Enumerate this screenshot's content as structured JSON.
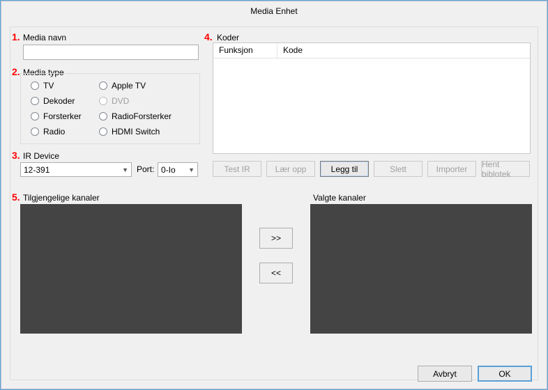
{
  "window": {
    "title": "Media Enhet"
  },
  "numbers": {
    "n1": "1.",
    "n2": "2.",
    "n3": "3.",
    "n4": "4.",
    "n5": "5."
  },
  "media_navn": {
    "label": "Media navn",
    "value": ""
  },
  "media_type": {
    "label": "Media type",
    "options": {
      "tv": "TV",
      "dekoder": "Dekoder",
      "forsterker": "Forsterker",
      "radio": "Radio",
      "apple_tv": "Apple TV",
      "dvd": "DVD",
      "radio_forsterker": "RadioForsterker",
      "hdmi_switch": "HDMI Switch"
    }
  },
  "ir_device": {
    "label": "IR Device",
    "value": "12-391",
    "port_label": "Port:",
    "port_value": "0-Io"
  },
  "koder": {
    "label": "Koder",
    "columns": {
      "funksjon": "Funksjon",
      "kode": "Kode"
    },
    "buttons": {
      "test_ir": "Test IR",
      "laer_opp": "Lær opp",
      "legg_til": "Legg til",
      "slett": "Slett",
      "importer": "Importer",
      "hent_biblotek": "Hent biblotek"
    }
  },
  "channels": {
    "available_label": "Tilgjengelige kanaler",
    "selected_label": "Valgte kanaler",
    "move_right": ">>",
    "move_left": "<<"
  },
  "dialog": {
    "avbryt": "Avbryt",
    "ok": "OK"
  }
}
